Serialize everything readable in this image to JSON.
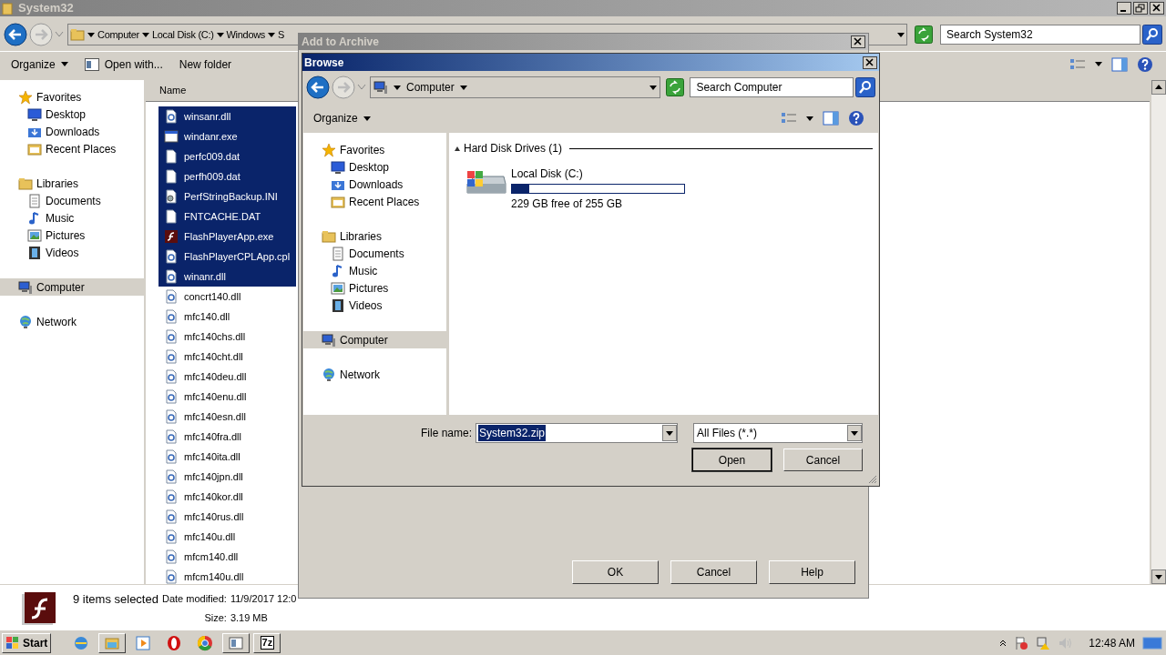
{
  "explorer": {
    "title": "System32",
    "breadcrumb": [
      "Computer",
      "Local Disk (C:)",
      "Windows",
      "S"
    ],
    "search_placeholder": "Search System32",
    "toolbar": [
      "Organize",
      "Open with...",
      "New folder"
    ],
    "nav": [
      {
        "label": "Favorites",
        "kind": "star",
        "selected": false,
        "children": [
          {
            "label": "Desktop",
            "kind": "desktop",
            "selected": false
          },
          {
            "label": "Downloads",
            "kind": "download",
            "selected": false
          },
          {
            "label": "Recent Places",
            "kind": "recent",
            "selected": false
          }
        ]
      },
      {
        "label": "Libraries",
        "kind": "library",
        "selected": false,
        "children": [
          {
            "label": "Documents",
            "kind": "document",
            "selected": false
          },
          {
            "label": "Music",
            "kind": "music",
            "selected": false
          },
          {
            "label": "Pictures",
            "kind": "pictures",
            "selected": false
          },
          {
            "label": "Videos",
            "kind": "video",
            "selected": false
          }
        ]
      },
      {
        "label": "Computer",
        "kind": "computer",
        "selected": true
      },
      {
        "label": "Network",
        "kind": "network",
        "selected": false
      }
    ],
    "column": "Name",
    "files": [
      {
        "name": "winsanr.dll",
        "kind": "dll",
        "selected": true
      },
      {
        "name": "windanr.exe",
        "kind": "exe",
        "selected": true
      },
      {
        "name": "perfc009.dat",
        "kind": "file",
        "selected": true
      },
      {
        "name": "perfh009.dat",
        "kind": "file",
        "selected": true
      },
      {
        "name": "PerfStringBackup.INI",
        "kind": "ini",
        "selected": true
      },
      {
        "name": "FNTCACHE.DAT",
        "kind": "file",
        "selected": true
      },
      {
        "name": "FlashPlayerApp.exe",
        "kind": "flash",
        "selected": true
      },
      {
        "name": "FlashPlayerCPLApp.cpl",
        "kind": "dll",
        "selected": true
      },
      {
        "name": "winanr.dll",
        "kind": "dll",
        "selected": true
      },
      {
        "name": "concrt140.dll",
        "kind": "dll",
        "selected": false
      },
      {
        "name": "mfc140.dll",
        "kind": "dll",
        "selected": false
      },
      {
        "name": "mfc140chs.dll",
        "kind": "dll",
        "selected": false
      },
      {
        "name": "mfc140cht.dll",
        "kind": "dll",
        "selected": false
      },
      {
        "name": "mfc140deu.dll",
        "kind": "dll",
        "selected": false
      },
      {
        "name": "mfc140enu.dll",
        "kind": "dll",
        "selected": false
      },
      {
        "name": "mfc140esn.dll",
        "kind": "dll",
        "selected": false
      },
      {
        "name": "mfc140fra.dll",
        "kind": "dll",
        "selected": false
      },
      {
        "name": "mfc140ita.dll",
        "kind": "dll",
        "selected": false
      },
      {
        "name": "mfc140jpn.dll",
        "kind": "dll",
        "selected": false
      },
      {
        "name": "mfc140kor.dll",
        "kind": "dll",
        "selected": false
      },
      {
        "name": "mfc140rus.dll",
        "kind": "dll",
        "selected": false
      },
      {
        "name": "mfc140u.dll",
        "kind": "dll",
        "selected": false
      },
      {
        "name": "mfcm140.dll",
        "kind": "dll",
        "selected": false
      },
      {
        "name": "mfcm140u.dll",
        "kind": "dll",
        "selected": false
      }
    ],
    "details": {
      "summary": "9 items selected",
      "date_label": "Date modified:",
      "date_value": "11/9/2017 12:0",
      "size_label": "Size:",
      "size_value": "3.19 MB"
    }
  },
  "add_to_archive": {
    "title": "Add to Archive",
    "buttons": [
      "OK",
      "Cancel",
      "Help"
    ]
  },
  "browse": {
    "title": "Browse",
    "breadcrumb": [
      "Computer"
    ],
    "search_placeholder": "Search Computer",
    "toolbar": [
      "Organize"
    ],
    "nav": [
      {
        "label": "Favorites",
        "kind": "star",
        "selected": false,
        "children": [
          {
            "label": "Desktop",
            "kind": "desktop",
            "selected": false
          },
          {
            "label": "Downloads",
            "kind": "download",
            "selected": false
          },
          {
            "label": "Recent Places",
            "kind": "recent",
            "selected": false
          }
        ]
      },
      {
        "label": "Libraries",
        "kind": "library",
        "selected": false,
        "children": [
          {
            "label": "Documents",
            "kind": "document",
            "selected": false
          },
          {
            "label": "Music",
            "kind": "music",
            "selected": false
          },
          {
            "label": "Pictures",
            "kind": "pictures",
            "selected": false
          },
          {
            "label": "Videos",
            "kind": "video",
            "selected": false
          }
        ]
      },
      {
        "label": "Computer",
        "kind": "computer",
        "selected": true
      },
      {
        "label": "Network",
        "kind": "network",
        "selected": false
      }
    ],
    "group": "Hard Disk Drives (1)",
    "drives": [
      {
        "name": "Local Disk (C:)",
        "level": 0.1,
        "free": "229 GB free of 255 GB"
      }
    ],
    "file_name_label": "File name:",
    "file_name": "System32.zip",
    "filter": "All Files (*.*)",
    "buttons": [
      "Open",
      "Cancel"
    ]
  },
  "taskbar": {
    "start": "Start",
    "apps": [
      {
        "kind": "globe",
        "open": false
      },
      {
        "kind": "folder",
        "open": true
      },
      {
        "kind": "media",
        "open": false
      },
      {
        "kind": "ring",
        "open": false
      },
      {
        "kind": "chrome",
        "open": false
      },
      {
        "kind": "window",
        "open": true
      },
      {
        "kind": "archiver",
        "label": "7z",
        "open": true
      }
    ],
    "clock": "12:48 AM"
  }
}
